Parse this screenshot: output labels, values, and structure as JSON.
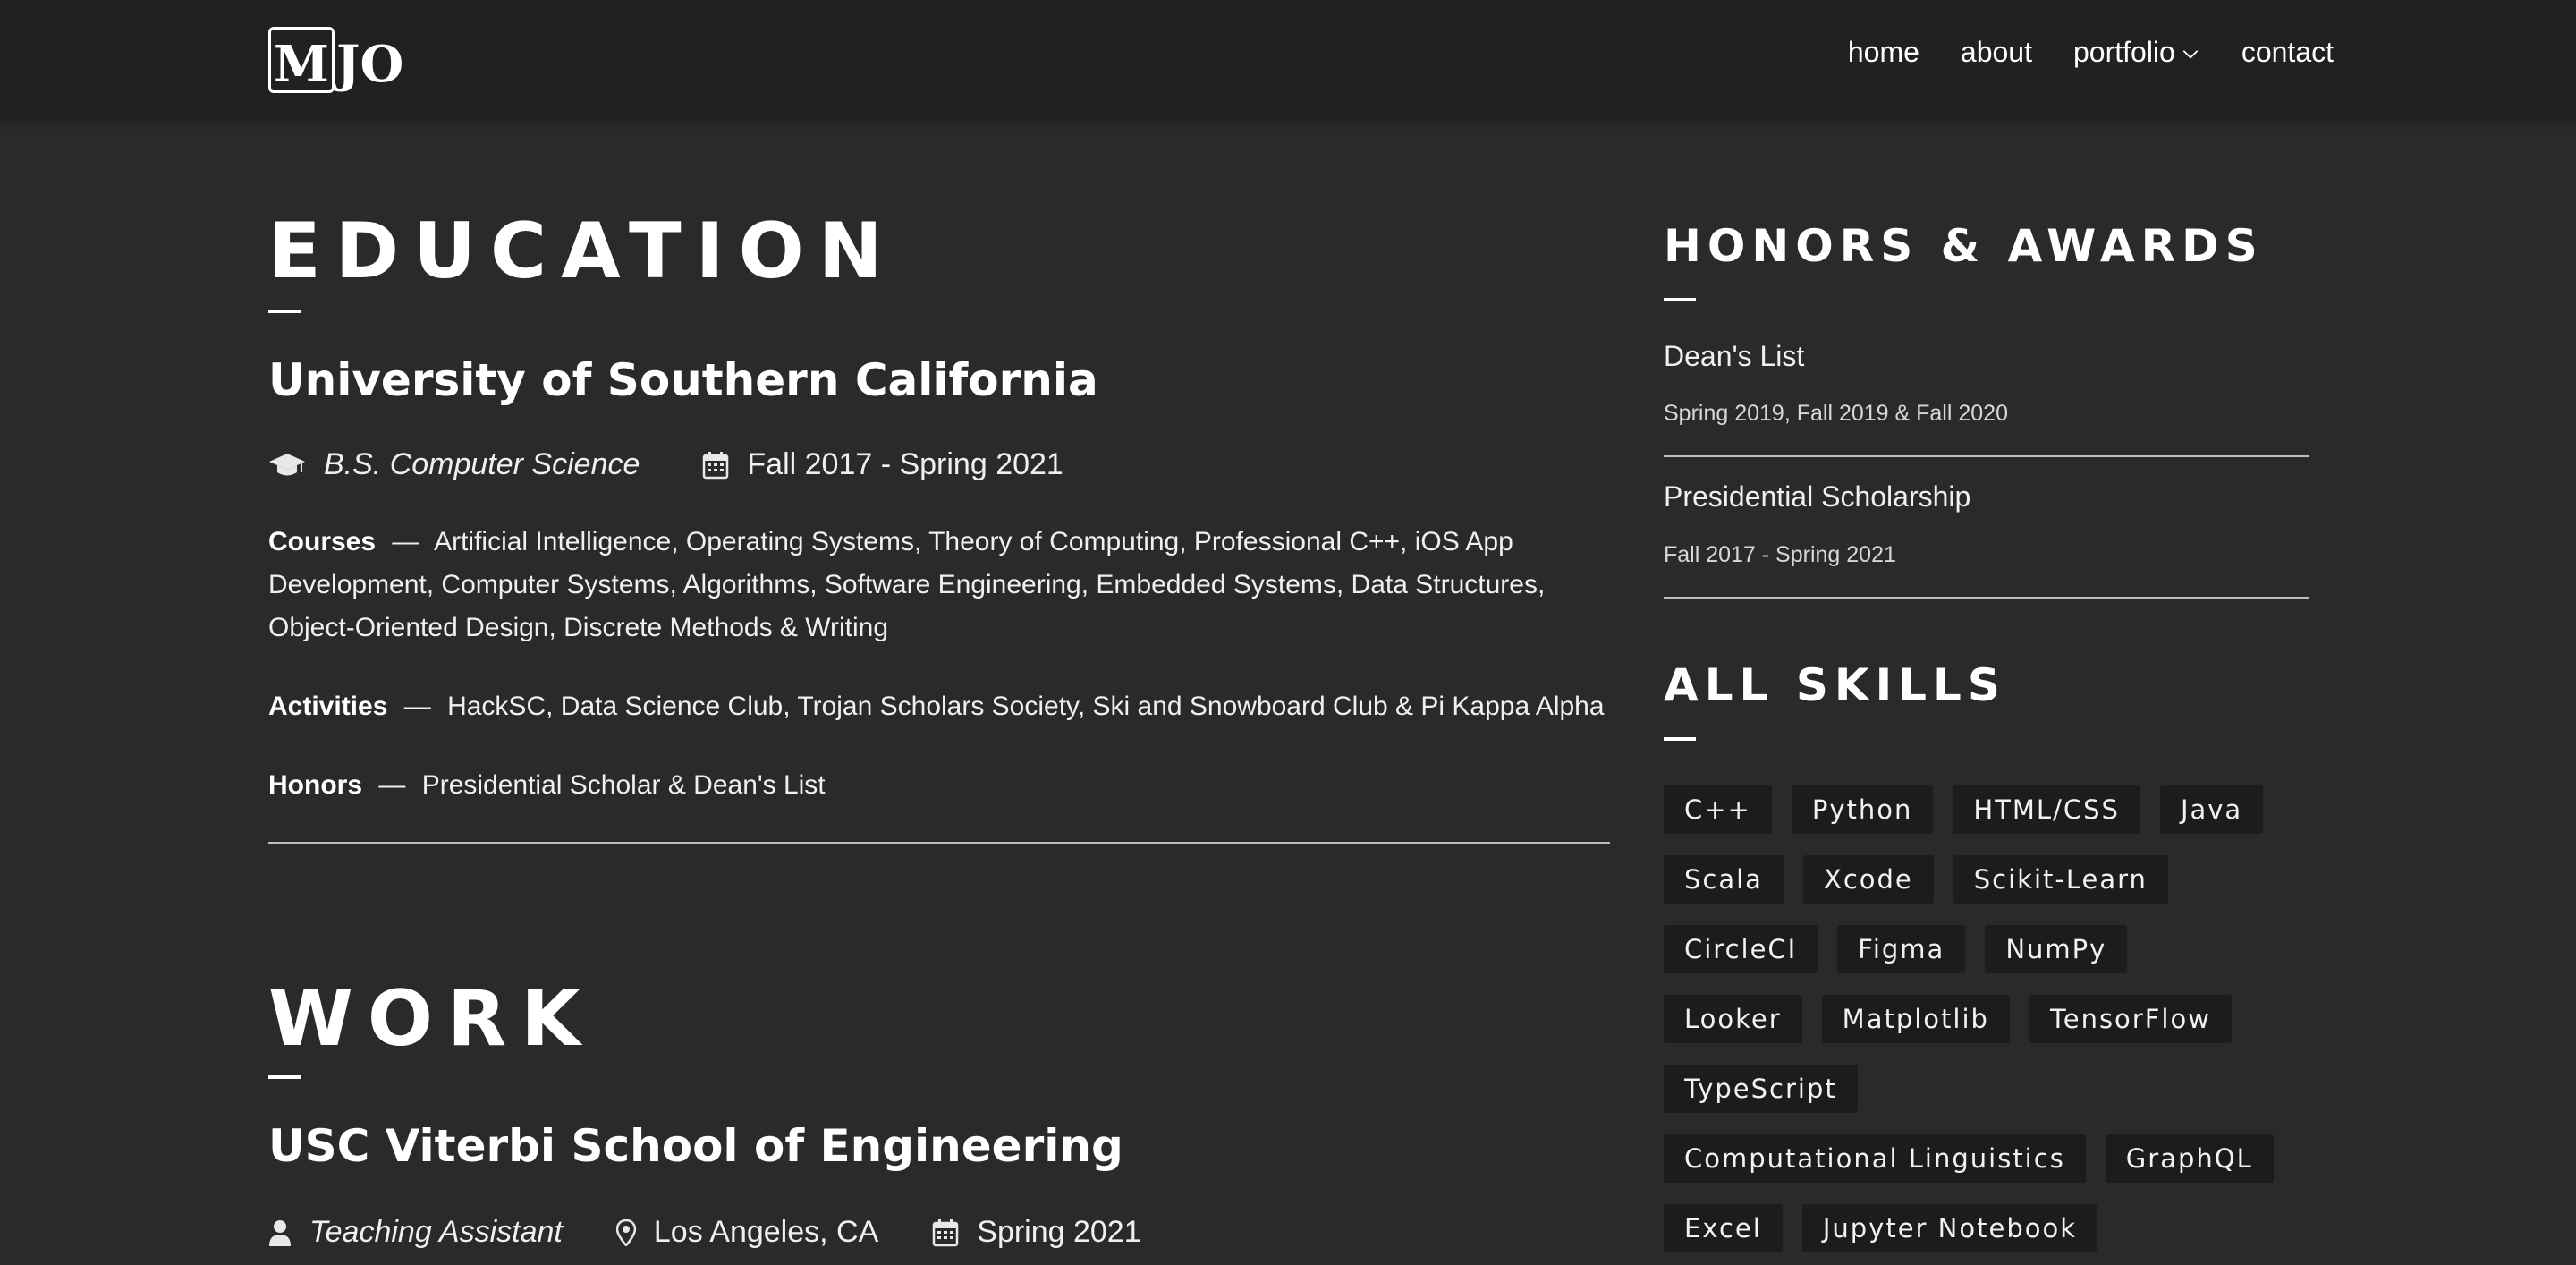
{
  "logo": {
    "box_letter": "M",
    "rest": "JO"
  },
  "nav": [
    {
      "label": "home"
    },
    {
      "label": "about"
    },
    {
      "label": "portfolio"
    },
    {
      "label": "contact"
    }
  ],
  "education": {
    "title": "EDUCATION",
    "school": "University of Southern California",
    "degree": "B.S. Computer Science",
    "dates": "Fall 2017 - Spring 2021",
    "courses_label": "Courses",
    "courses": "Artificial Intelligence, Operating Systems, Theory of Computing, Professional C++, iOS App Development, Computer Systems, Algorithms, Software Engineering, Embedded Systems, Data Structures, Object-Oriented Design, Discrete Methods & Writing",
    "activities_label": "Activities",
    "activities": "HackSC, Data Science Club, Trojan Scholars Society, Ski and Snowboard Club & Pi Kappa Alpha",
    "honors_label": "Honors",
    "honors": "Presidential Scholar & Dean's List",
    "separator": "—"
  },
  "work": {
    "title": "WORK",
    "org": "USC Viterbi School of Engineering",
    "role": "Teaching Assistant",
    "location": "Los Angeles, CA",
    "dates": "Spring 2021"
  },
  "honors_awards": {
    "title": "HONORS & AWARDS",
    "items": [
      {
        "name": "Dean's List",
        "date": "Spring 2019, Fall 2019 & Fall 2020"
      },
      {
        "name": "Presidential Scholarship",
        "date": "Fall 2017 - Spring 2021"
      }
    ]
  },
  "skills": {
    "title": "ALL SKILLS",
    "rows": [
      [
        "C++",
        "Python",
        "HTML/CSS",
        "Java"
      ],
      [
        "Scala",
        "Xcode",
        "Scikit-Learn"
      ],
      [
        "CircleCI",
        "Figma",
        "NumPy"
      ],
      [
        "Looker",
        "Matplotlib",
        "TensorFlow"
      ],
      [
        "TypeScript"
      ],
      [
        "Computational Linguistics",
        "GraphQL"
      ],
      [
        "Excel",
        "Jupyter Notebook"
      ]
    ]
  },
  "colors": {
    "background": "#2a2a2a",
    "navbar": "#212121",
    "tag": "#1c1c1c",
    "text": "#f2f2f2"
  }
}
